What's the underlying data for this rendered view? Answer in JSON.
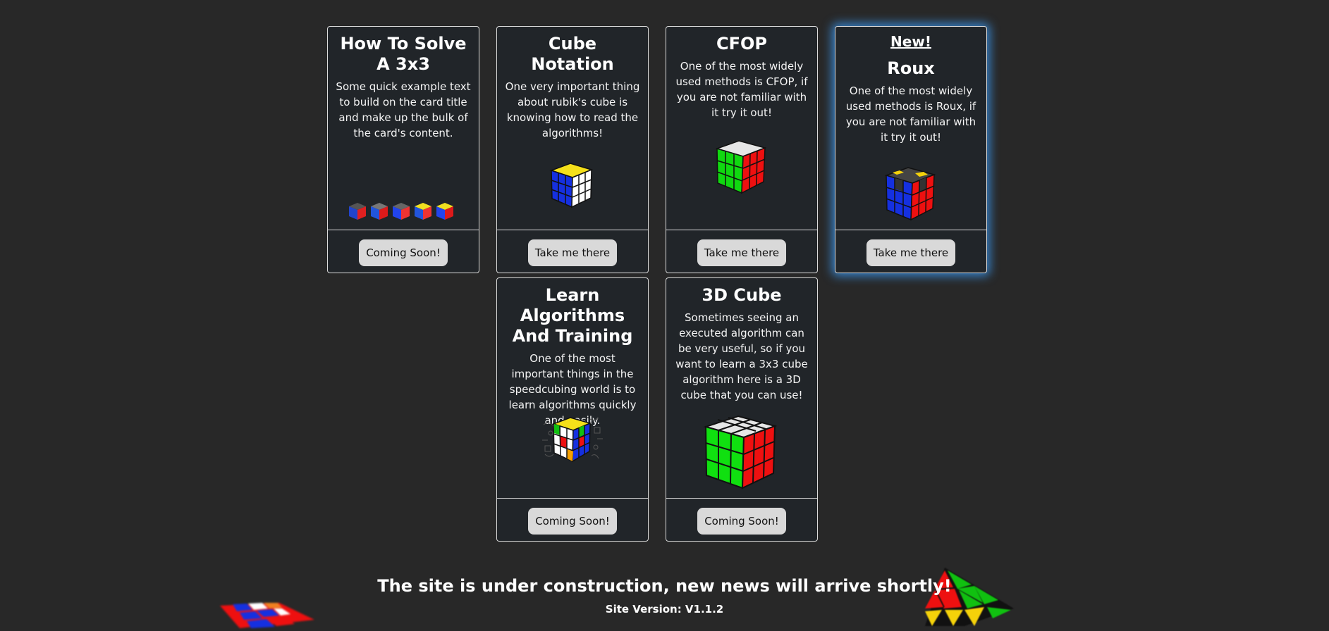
{
  "cards": [
    {
      "title": "How To Solve A 3x3",
      "text": "Some quick example text to build on the card title and make up the bulk of the card's content.",
      "button": "Coming Soon!",
      "image": "five-cubes-icon"
    },
    {
      "title": "Cube Notation",
      "text": "One very important thing about rubik's cube is knowing how to read the algorithms!",
      "button": "Take me there",
      "image": "notation-cube-icon"
    },
    {
      "title": "CFOP",
      "text": "One of the most widely used methods is CFOP, if you are not familiar with it try it out!",
      "button": "Take me there",
      "image": "cfop-cube-icon"
    },
    {
      "badge": "New!",
      "title": "Roux",
      "text": "One of the most widely used methods is Roux, if you are not familiar with it try it out!",
      "button": "Take me there",
      "image": "roux-cube-icon"
    },
    {
      "title": "Learn Algorithms And Training",
      "text": "One of the most important things in the speedcubing world is to learn algorithms quickly and easily.",
      "button": "Coming Soon!",
      "image": "algorithm-cube-icon"
    },
    {
      "title": "3D Cube",
      "text": "Sometimes seeing an executed algorithm can be very useful, so if you want to learn a 3x3 cube algorithm here is a 3D cube that you can use!",
      "button": "Coming Soon!",
      "image": "large-cube-icon"
    }
  ],
  "footer": {
    "message": "The site is under construction, new news will arrive shortly!",
    "version": "Site Version: V1.1.2"
  },
  "colors": {
    "background": "#282828",
    "card": "#212529",
    "glow": "#3ca0ff",
    "button": "#d9d9d9"
  }
}
